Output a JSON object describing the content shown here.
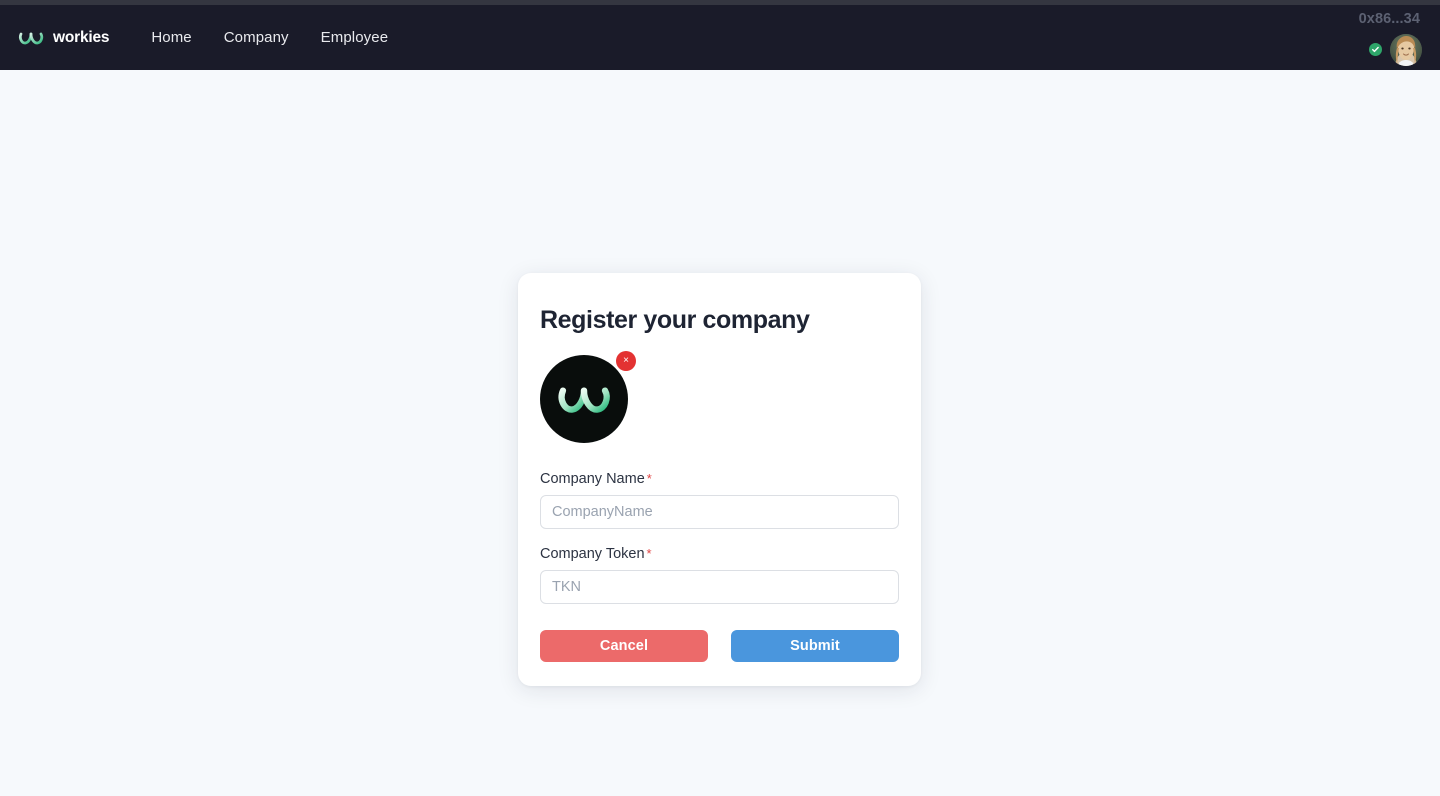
{
  "navbar": {
    "brand_name": "workies",
    "brand_logo_icon": "workies-w-logo-icon",
    "links": [
      {
        "label": "Home"
      },
      {
        "label": "Company"
      },
      {
        "label": "Employee"
      }
    ],
    "account": {
      "wallet_address": "0x86...34",
      "verified_icon": "check-circle-icon",
      "avatar_icon": "user-avatar-photo",
      "verified": true
    },
    "background_color": "#1a1b29",
    "top_strip_color": "#343640"
  },
  "card": {
    "title": "Register your company",
    "logo_upload": {
      "icon": "workies-w-logo-icon",
      "circle_color": "#090d0c",
      "remove_button_label": "×",
      "remove_button_color": "#e33232",
      "remove_icon": "close-icon"
    },
    "fields": [
      {
        "label": "Company Name",
        "required_mark": "*",
        "placeholder": "CompanyName",
        "value": ""
      },
      {
        "label": "Company Token",
        "required_mark": "*",
        "placeholder": "TKN",
        "value": ""
      }
    ],
    "buttons": {
      "cancel_label": "Cancel",
      "submit_label": "Submit",
      "cancel_color": "#ec6a6a",
      "submit_color": "#4a96dd"
    }
  },
  "page": {
    "background_color": "#f6f9fc"
  }
}
